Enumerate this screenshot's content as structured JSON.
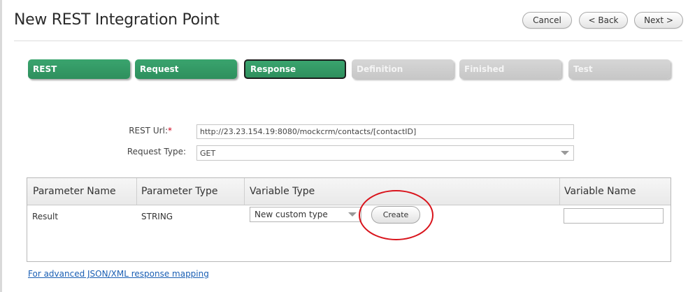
{
  "header": {
    "title": "New REST Integration Point",
    "cancel_label": "Cancel",
    "back_label": "< Back",
    "next_label": "Next >"
  },
  "steps": [
    {
      "label": "REST",
      "state": "done"
    },
    {
      "label": "Request",
      "state": "done"
    },
    {
      "label": "Response",
      "state": "active"
    },
    {
      "label": "Definition",
      "state": "todo"
    },
    {
      "label": "Finished",
      "state": "todo"
    },
    {
      "label": "Test",
      "state": "todo"
    }
  ],
  "form": {
    "rest_url_label": "REST Url:",
    "rest_url_required": "*",
    "rest_url_value": "http://23.23.154.19:8080/mockcrm/contacts/[contactID]",
    "request_type_label": "Request Type:",
    "request_type_value": "GET"
  },
  "grid": {
    "columns": [
      "Parameter Name",
      "Parameter Type",
      "Variable Type",
      "Variable Name"
    ],
    "rows": [
      {
        "parameter_name": "Result",
        "parameter_type": "STRING",
        "variable_type": "New custom type",
        "create_label": "Create",
        "variable_name": ""
      }
    ]
  },
  "advanced_link": "For advanced JSON/XML response mapping",
  "colors": {
    "step_done": "#2e8f5d",
    "step_todo": "#c7c7c7",
    "annotation": "#d9141c",
    "link": "#1a5fb4"
  }
}
